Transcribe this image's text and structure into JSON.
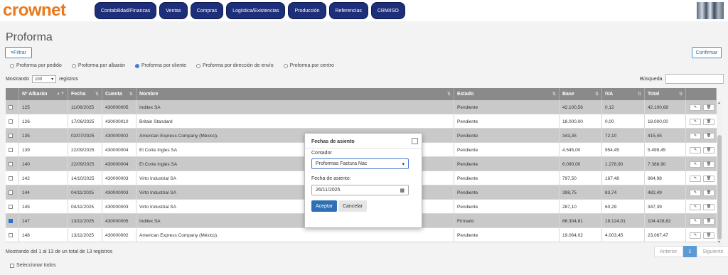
{
  "app": {
    "logo": "crownet"
  },
  "nav": [
    "Contabilidad/Finanzas",
    "Ventas",
    "Compras",
    "Logística/Existencias",
    "Producción",
    "Referencias",
    "CRM/ISO"
  ],
  "page": {
    "title": "Proforma",
    "filter_label": "Filtrar",
    "confirm_label": "Confirmar"
  },
  "radios": [
    {
      "label": "Proforma por pedido",
      "checked": false
    },
    {
      "label": "Proforma por albarán",
      "checked": false
    },
    {
      "label": "Proforma por cliente",
      "checked": true
    },
    {
      "label": "Proforma por dirección de envío",
      "checked": false
    },
    {
      "label": "Proforma por centro",
      "checked": false
    }
  ],
  "listing": {
    "showing_prefix": "Mostrando",
    "page_size": "100",
    "showing_suffix": "registros",
    "search_label": "Búsqueda"
  },
  "table": {
    "headers": [
      "Nº Albarán",
      "Fecha",
      "Cuenta",
      "Nombre",
      "Estado",
      "Base",
      "IVA",
      "Total"
    ],
    "rows": [
      {
        "albaran": "125",
        "fecha": "11/06/2025",
        "cuenta": "430000005",
        "nombre": "Inditex SA",
        "estado": "Pendiente",
        "base": "42.100,56",
        "iva": "0,12",
        "total": "42.100,68",
        "checked": false,
        "shaded": true
      },
      {
        "albaran": "126",
        "fecha": "17/06/2025",
        "cuenta": "430000010",
        "nombre": "Britain Standard",
        "estado": "Pendiente",
        "base": "18.000,00",
        "iva": "0,00",
        "total": "18.000,00",
        "checked": false,
        "shaded": false
      },
      {
        "albaran": "135",
        "fecha": "02/07/2025",
        "cuenta": "430000002",
        "nombre": "American Express Company (México).",
        "estado": "Pendiente",
        "base": "343,35",
        "iva": "72,10",
        "total": "415,45",
        "checked": false,
        "shaded": true
      },
      {
        "albaran": "139",
        "fecha": "22/09/2025",
        "cuenta": "430000004",
        "nombre": "El Corte Ingles SA",
        "estado": "Pendiente",
        "base": "4.545,00",
        "iva": "954,45",
        "total": "5.499,45",
        "checked": false,
        "shaded": false
      },
      {
        "albaran": "140",
        "fecha": "22/09/2025",
        "cuenta": "430000004",
        "nombre": "El Corte Ingles SA",
        "estado": "Pendiente",
        "base": "6.090,00",
        "iva": "1.278,90",
        "total": "7.368,90",
        "checked": false,
        "shaded": true
      },
      {
        "albaran": "142",
        "fecha": "14/10/2025",
        "cuenta": "430000003",
        "nombre": "Virto Industrial SA",
        "estado": "Pendiente",
        "base": "797,50",
        "iva": "167,48",
        "total": "964,98",
        "checked": false,
        "shaded": false
      },
      {
        "albaran": "144",
        "fecha": "04/11/2025",
        "cuenta": "430000003",
        "nombre": "Virto Industrial SA",
        "estado": "Pendiente",
        "base": "398,75",
        "iva": "83,74",
        "total": "482,49",
        "checked": false,
        "shaded": true
      },
      {
        "albaran": "145",
        "fecha": "04/11/2025",
        "cuenta": "430000003",
        "nombre": "Virto Industrial SA",
        "estado": "Pendiente",
        "base": "287,10",
        "iva": "60,29",
        "total": "347,39",
        "checked": false,
        "shaded": false
      },
      {
        "albaran": "147",
        "fecha": "13/11/2025",
        "cuenta": "430000005",
        "nombre": "Inditex SA",
        "estado": "Firmado",
        "base": "86.304,81",
        "iva": "18.124,01",
        "total": "104.428,82",
        "checked": true,
        "shaded": true
      },
      {
        "albaran": "148",
        "fecha": "13/11/2025",
        "cuenta": "430000002",
        "nombre": "American Express Company (México).",
        "estado": "Pendiente",
        "base": "19.064,02",
        "iva": "4.003,45",
        "total": "23.067,47",
        "checked": false,
        "shaded": false
      }
    ]
  },
  "footer": {
    "info": "Mostrando del 1 al 13 de un total de 13 registros",
    "prev": "Anterior",
    "page": "1",
    "next": "Siguiente",
    "select_all": "Seleccionar todos"
  },
  "modal": {
    "title": "Fechas de asiento",
    "counter_label": "Contador",
    "counter_value": "Proformas Factura Nac",
    "date_label": "Fecha de asiento:",
    "date_value": "26/11/2025",
    "accept": "Aceptar",
    "cancel": "Cancelar"
  },
  "colors": {
    "nav_bg": "#1e2f7a",
    "logo": "#e8791e",
    "header_bg": "#8a8a8a",
    "row_shade": "#c9c9c9",
    "accept_bg": "#2f6fb5"
  }
}
